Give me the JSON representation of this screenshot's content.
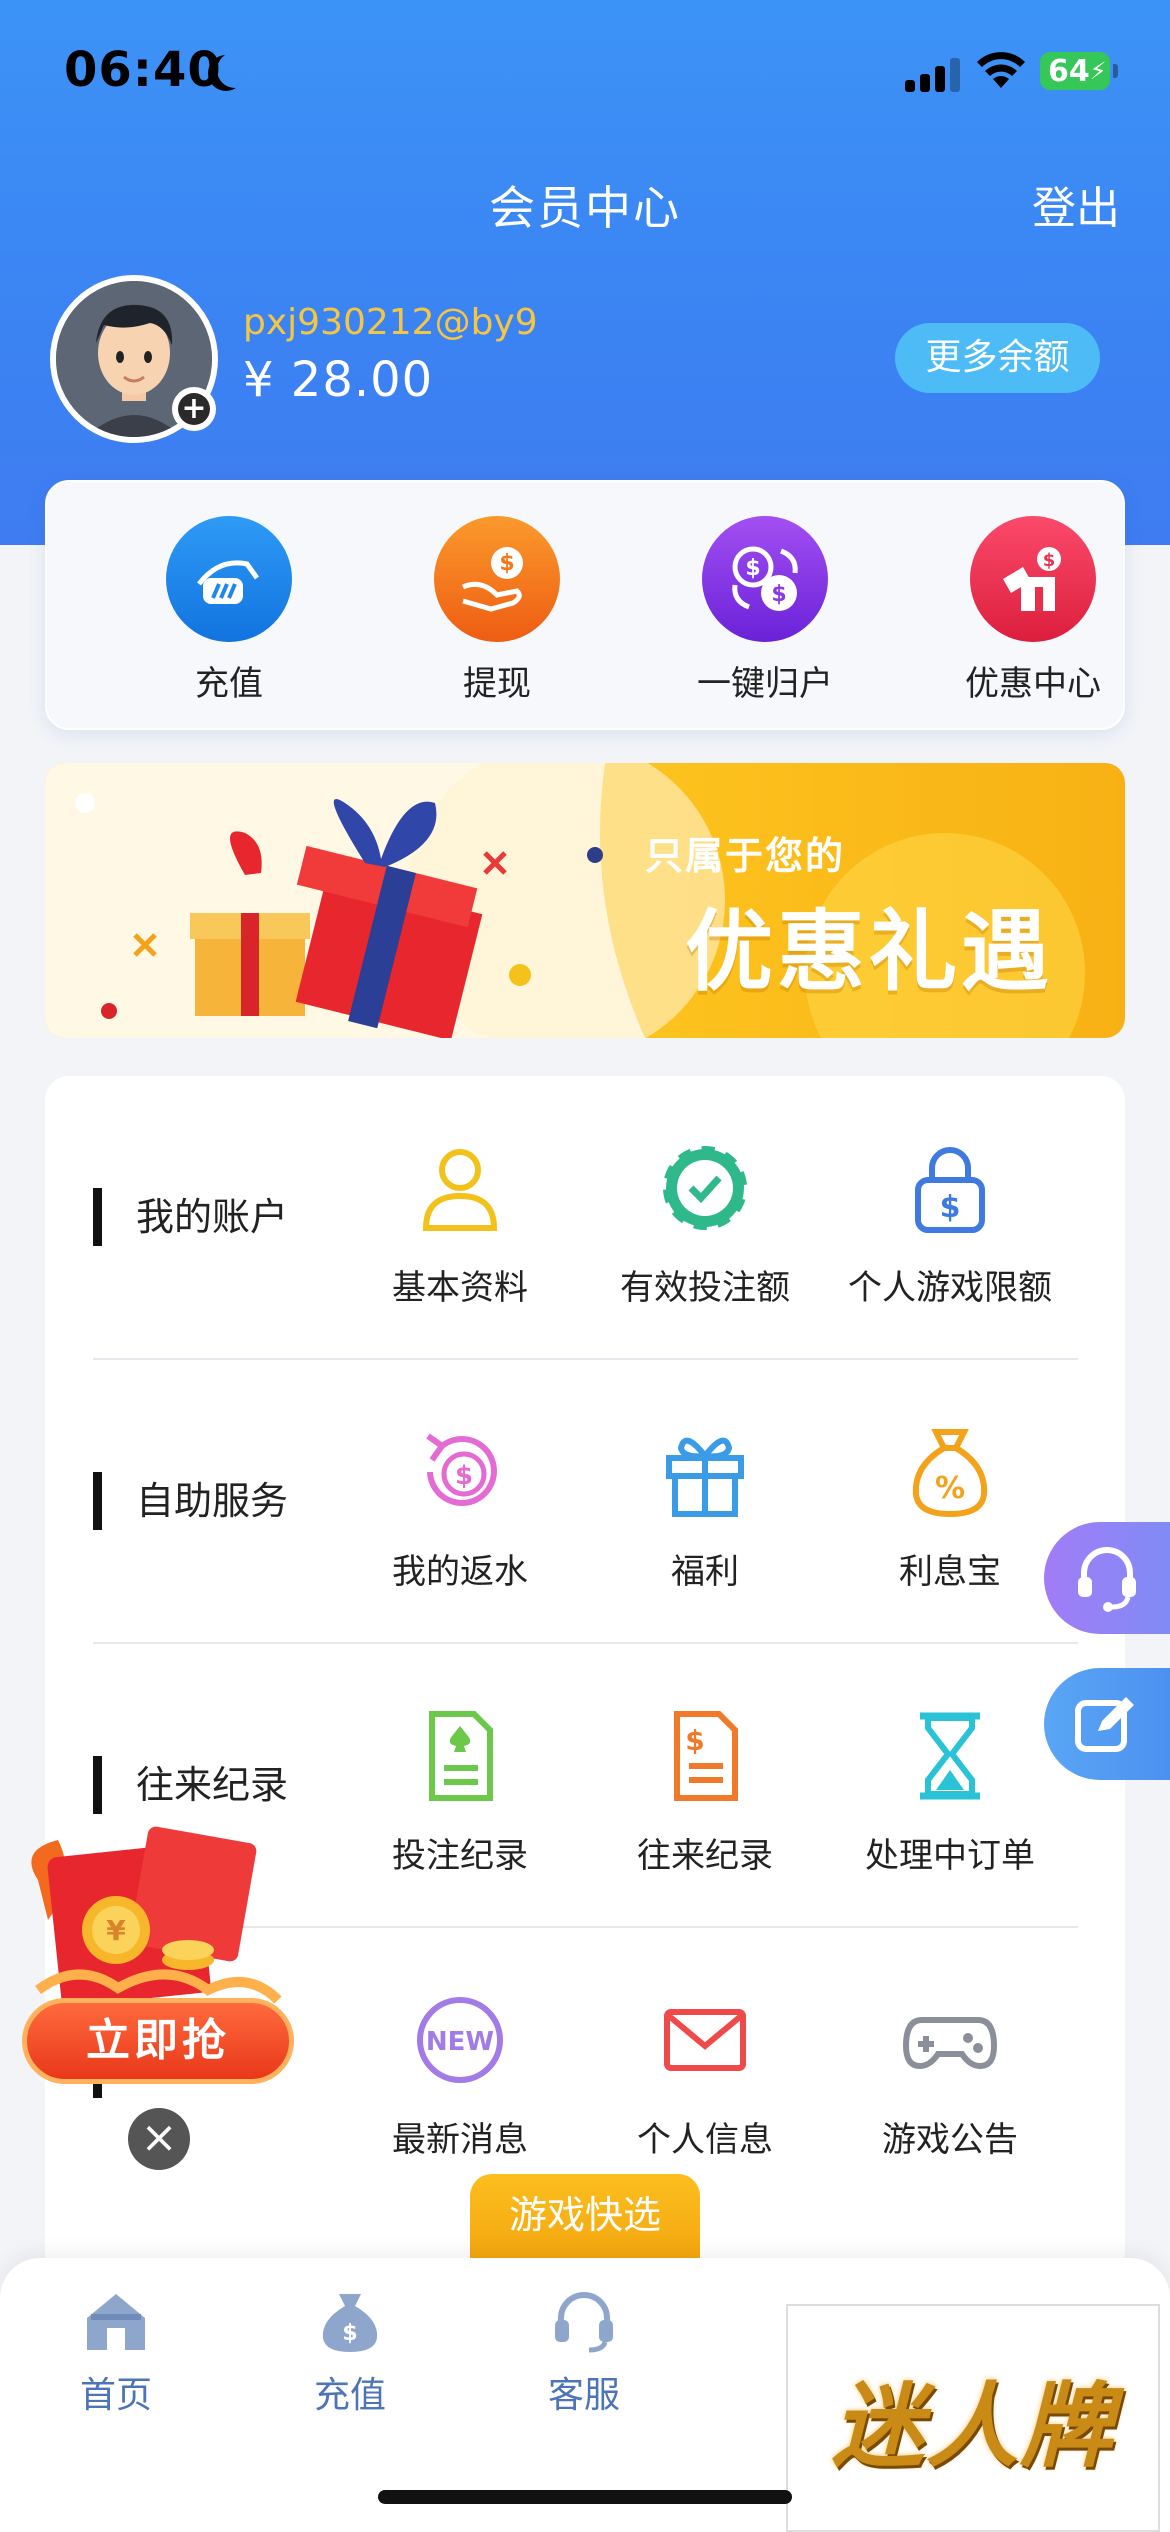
{
  "status_bar": {
    "time": "06:40",
    "battery": "64"
  },
  "header": {
    "title": "会员中心",
    "logout": "登出"
  },
  "profile": {
    "username": "pxj930212@by9",
    "balance": "¥ 28.00",
    "more_balance": "更多余额",
    "plus": "+"
  },
  "quick_actions": [
    {
      "label": "充值",
      "icon": "deposit-hand-icon",
      "color": "#1e86ee"
    },
    {
      "label": "提现",
      "icon": "withdraw-hand-icon",
      "color": "#f27a1a"
    },
    {
      "label": "一键归户",
      "icon": "transfer-coins-icon",
      "color": "#8a3be6"
    },
    {
      "label": "优惠中心",
      "icon": "gift-coupon-icon",
      "color": "#e8304d"
    }
  ],
  "banner": {
    "subtitle": "只属于您的",
    "title": "优惠礼遇"
  },
  "menu_sections": [
    {
      "title": "我的账户",
      "items": [
        {
          "label": "基本资料",
          "icon": "user-icon",
          "color": "#f2c21a"
        },
        {
          "label": "有效投注额",
          "icon": "chip-check-icon",
          "color": "#2fb98a"
        },
        {
          "label": "个人游戏限额",
          "icon": "lock-dollar-icon",
          "color": "#3f7ae0"
        }
      ]
    },
    {
      "title": "自助服务",
      "items": [
        {
          "label": "我的返水",
          "icon": "rebate-dollar-icon",
          "color": "#e46bd3"
        },
        {
          "label": "福利",
          "icon": "gift-icon",
          "color": "#3a9be6"
        },
        {
          "label": "利息宝",
          "icon": "money-bag-icon",
          "color": "#f3a21a"
        }
      ]
    },
    {
      "title": "往来纪录",
      "items": [
        {
          "label": "投注纪录",
          "icon": "bet-record-icon",
          "color": "#6cc84a"
        },
        {
          "label": "往来纪录",
          "icon": "transaction-doc-icon",
          "color": "#f07a2a"
        },
        {
          "label": "处理中订单",
          "icon": "hourglass-icon",
          "color": "#29c2d6"
        }
      ]
    },
    {
      "title": "",
      "items": [
        {
          "label": "最新消息",
          "icon": "new-badge-icon",
          "color": "#a27be6"
        },
        {
          "label": "个人信息",
          "icon": "mail-icon",
          "color": "#ee4a4a"
        },
        {
          "label": "游戏公告",
          "icon": "gamepad-icon",
          "color": "#8a8f99"
        }
      ]
    }
  ],
  "quick_pick": "游戏快选",
  "promo": {
    "grab": "立即抢",
    "close": "×"
  },
  "tabbar": [
    {
      "label": "首页",
      "icon": "home-icon"
    },
    {
      "label": "充值",
      "icon": "money-bag-icon"
    },
    {
      "label": "客服",
      "icon": "headset-icon"
    }
  ],
  "watermark": "迷人牌"
}
